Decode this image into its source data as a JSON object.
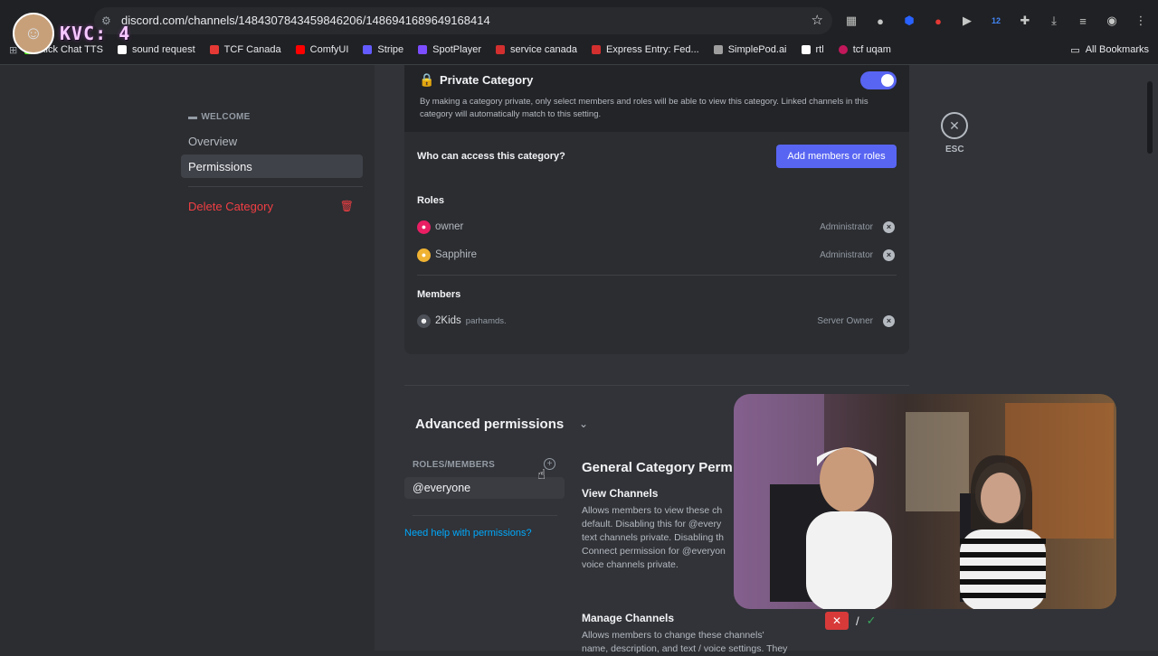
{
  "browser": {
    "url": "discord.com/channels/1484307843459846206/1486941689649168414",
    "overlay_text": "KVC: 4",
    "bookmarks": [
      {
        "label": "Kick Chat TTS",
        "color": "#53fc18"
      },
      {
        "label": "sound request",
        "color": "#ffffff"
      },
      {
        "label": "TCF Canada",
        "color": "#e53935"
      },
      {
        "label": "ComfyUI",
        "color": "#ff0000"
      },
      {
        "label": "Stripe",
        "color": "#635bff"
      },
      {
        "label": "SpotPlayer",
        "color": "#7c4dff"
      },
      {
        "label": "service canada",
        "color": "#d32f2f"
      },
      {
        "label": "Express Entry: Fed...",
        "color": "#d32f2f"
      },
      {
        "label": "SimplePod.ai",
        "color": "#9e9e9e"
      },
      {
        "label": "rtl",
        "color": "#ffffff"
      },
      {
        "label": "tcf uqam",
        "color": "#c2185b"
      }
    ],
    "all_bookmarks": "All Bookmarks",
    "ext_badge": "12"
  },
  "sidebar": {
    "section": "WELCOME",
    "items": [
      {
        "label": "Overview",
        "active": false
      },
      {
        "label": "Permissions",
        "active": true
      }
    ],
    "delete_label": "Delete Category"
  },
  "private_category": {
    "title": "Private Category",
    "enabled": true,
    "description": "By making a category private, only select members and roles will be able to view this category. Linked channels in this category will automatically match to this setting.",
    "who_label": "Who can access this category?",
    "add_button": "Add members or roles",
    "roles_label": "Roles",
    "roles": [
      {
        "name": "owner",
        "right": "Administrator",
        "color": "#e91e63"
      },
      {
        "name": "Sapphire",
        "right": "Administrator",
        "color": "#f0b232"
      }
    ],
    "members_label": "Members",
    "members": [
      {
        "name": "2Kids",
        "sub": "parhamds.",
        "right": "Server Owner"
      }
    ]
  },
  "esc": {
    "label": "ESC"
  },
  "advanced": {
    "title": "Advanced permissions",
    "roles_members_label": "ROLES/MEMBERS",
    "selected_role": "@everyone",
    "help_link": "Need help with permissions?",
    "section_title": "General Category Perm",
    "permissions": [
      {
        "name": "View Channels",
        "description_lines": [
          "Allows members to view these ch",
          "default. Disabling this for @every",
          "text channels private. Disabling th",
          "Connect permission for @everyon",
          "voice channels private."
        ]
      },
      {
        "name": "Manage Channels",
        "description_lines": [
          "Allows members to change these channels'",
          "name, description, and text / voice settings. They"
        ]
      }
    ]
  }
}
